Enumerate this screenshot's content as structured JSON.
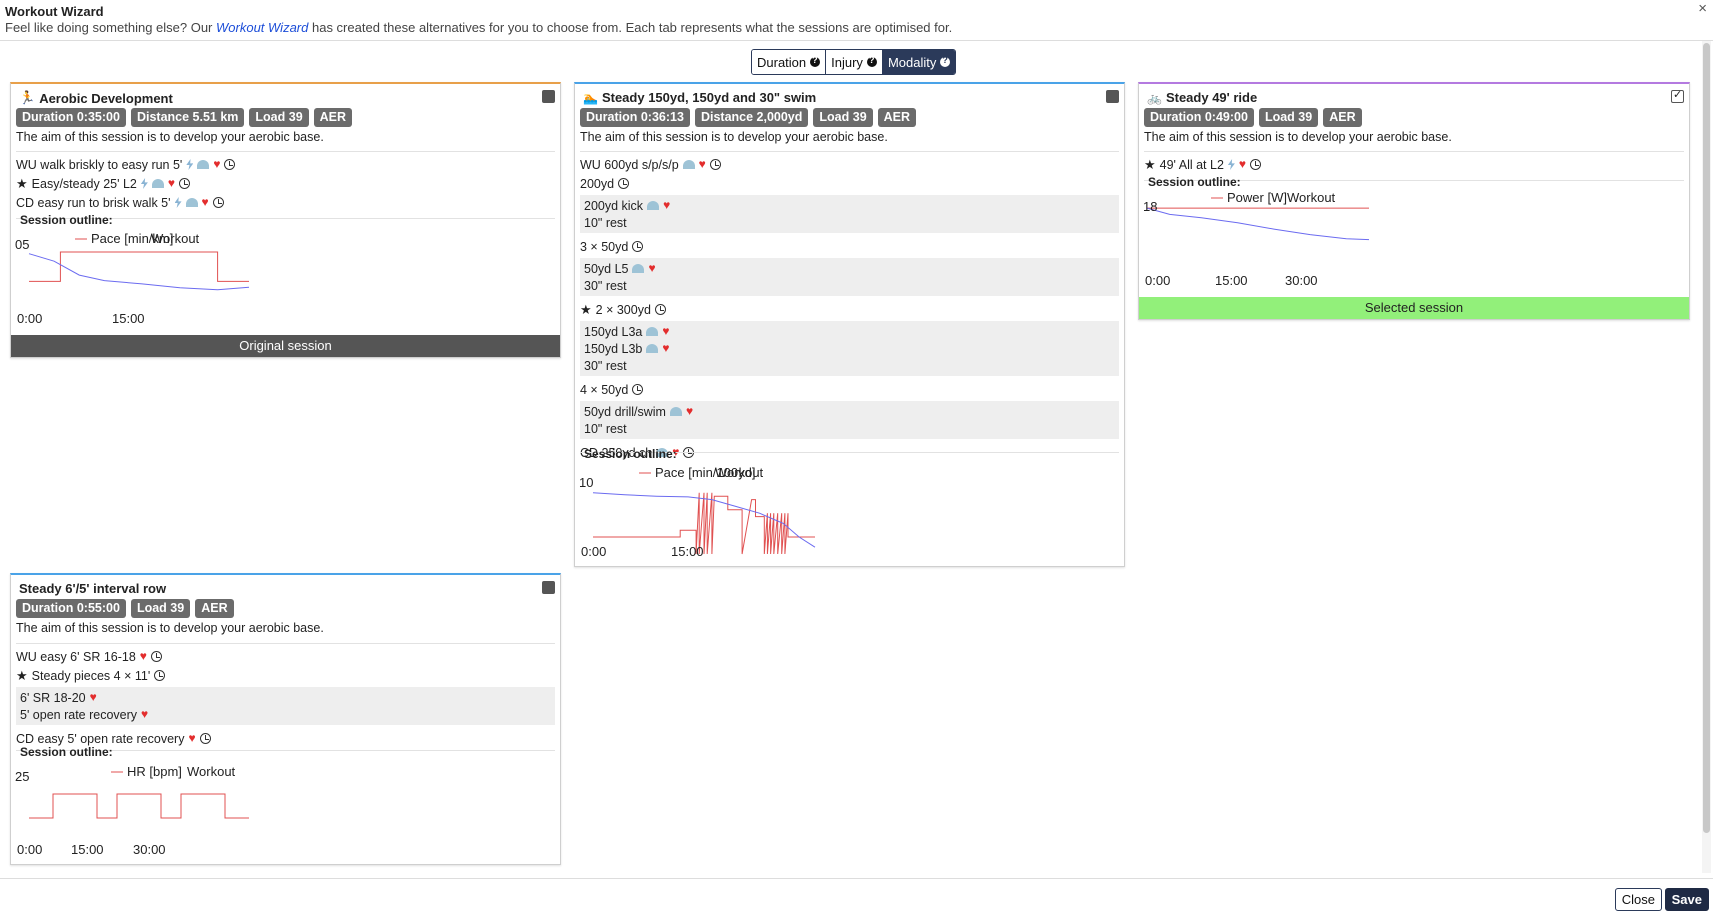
{
  "dialog": {
    "title": "Workout Wizard",
    "subtitle_pre": "Feel like doing something else? Our ",
    "subtitle_link": "Workout Wizard",
    "subtitle_post": " has created these alternatives for you to choose from. Each tab represents what the sessions are optimised for.",
    "close_x": "×"
  },
  "tabs": [
    {
      "label": "Duration",
      "active": false
    },
    {
      "label": "Injury",
      "active": false
    },
    {
      "label": "Modality",
      "active": true
    }
  ],
  "cards": {
    "run": {
      "title": "Aerobic Development",
      "border_color": "#e8a04a",
      "checked": false,
      "badges": [
        "Duration 0:35:00",
        "Distance 5.51 km",
        "Load 39",
        "AER"
      ],
      "aim": "The aim of this session is to develop your aerobic base.",
      "steps": [
        {
          "text": "WU walk briskly to easy run 5'",
          "icons": [
            "bolt",
            "gauge",
            "heart",
            "clock"
          ]
        },
        {
          "text": "Easy/steady 25' L2",
          "star": true,
          "icons": [
            "bolt",
            "gauge",
            "heart",
            "clock"
          ]
        },
        {
          "text": "CD easy run to brisk walk 5'",
          "icons": [
            "bolt",
            "gauge",
            "heart",
            "clock"
          ]
        }
      ],
      "outline_label": "Session outline:",
      "footer": "Original session"
    },
    "swim": {
      "title": "Steady 150yd, 150yd and 30\" swim",
      "border_color": "#4aa3e8",
      "checked": false,
      "badges": [
        "Duration 0:36:13",
        "Distance 2,000yd",
        "Load 39",
        "AER"
      ],
      "aim": "The aim of this session is to develop your aerobic base.",
      "outline_label": "Session outline:",
      "steps": {
        "wu": "WU 600yd s/p/s/p",
        "s200": "200yd",
        "g1a": "200yd kick",
        "g1b": "10\" rest",
        "rep3": "3 × 50yd",
        "g2a": "50yd L5",
        "g2b": "30\" rest",
        "rep2": "2 × 300yd",
        "g3a": "150yd L3a",
        "g3b": "150yd L3b",
        "g3c": "30\" rest",
        "rep4": "4 × 50yd",
        "g4a": "50yd drill/swim",
        "g4b": "10\" rest",
        "cd": "CD 250yd ch"
      }
    },
    "ride": {
      "title": "Steady 49' ride",
      "border_color": "#b47ae0",
      "checked": true,
      "badges": [
        "Duration 0:49:00",
        "Load 39",
        "AER"
      ],
      "aim": "The aim of this session is to develop your aerobic base.",
      "steps": [
        {
          "text": "49' All at L2",
          "star": true,
          "icons": [
            "bolt",
            "heart",
            "clock"
          ]
        }
      ],
      "outline_label": "Session outline:",
      "footer": "Selected session"
    },
    "row": {
      "title": "Steady 6'/5' interval row",
      "border_color": "#4aa3e8",
      "checked": false,
      "badges": [
        "Duration 0:55:00",
        "Load 39",
        "AER"
      ],
      "aim": "The aim of this session is to develop your aerobic base.",
      "outline_label": "Session outline:",
      "steps": {
        "wu": "WU easy 6' SR 16-18",
        "main": "Steady pieces 4 × 11'",
        "g1a": "6' SR 18-20",
        "g1b": "5' open rate recovery",
        "cd": "CD easy 5' open rate recovery"
      }
    }
  },
  "chart_data": [
    {
      "type": "line",
      "legend": [
        "Pace [min/km]",
        "Workout"
      ],
      "x_tick_labels": [
        "0:00",
        "15:00"
      ],
      "y_tick_labels": [
        "05"
      ],
      "series": [
        {
          "name": "Workout",
          "color": "#e05050",
          "x": [
            0,
            5,
            5,
            30,
            30,
            35
          ],
          "y": [
            0.3,
            0.3,
            1.0,
            1.0,
            0.3,
            0.3
          ]
        },
        {
          "name": "Pace [min/km]",
          "color": "#6b6bf0",
          "x": [
            0,
            4,
            8,
            12,
            18,
            24,
            30,
            35
          ],
          "y": [
            0.96,
            0.78,
            0.45,
            0.32,
            0.24,
            0.15,
            0.1,
            0.16
          ]
        }
      ]
    },
    {
      "type": "line",
      "legend": [
        "Pace [min/100yd]",
        "Workout"
      ],
      "x_tick_labels": [
        "0:00",
        "15:00"
      ],
      "y_tick_labels": [
        "10"
      ],
      "series": [
        {
          "name": "Workout",
          "color": "#e05050",
          "x": [
            0,
            11,
            11,
            13,
            13,
            13.4,
            13.4,
            14,
            14,
            14.4,
            14.4,
            15,
            15,
            15.3,
            15.3,
            17,
            17,
            18.8,
            18.8,
            20,
            20,
            20.5,
            20.5,
            21.6,
            21.6,
            22,
            22,
            22.4,
            22.4,
            22.8,
            22.8,
            23.3,
            23.3,
            23.8,
            23.8,
            24.2,
            24.2,
            24.6,
            24.6,
            25.2,
            25.2,
            28
          ],
          "y": [
            0.25,
            0.25,
            0.35,
            0.35,
            0.0,
            0.9,
            0.0,
            0.9,
            0.0,
            0.9,
            0.0,
            0.9,
            0.0,
            0.85,
            0.85,
            0.85,
            0.65,
            0.65,
            0.0,
            0.8,
            0.8,
            0.8,
            0.55,
            0.55,
            0.0,
            0.6,
            0.0,
            0.6,
            0.0,
            0.6,
            0.0,
            0.6,
            0.0,
            0.6,
            0.0,
            0.6,
            0.0,
            0.6,
            0.25,
            0.25,
            0.25,
            0.25
          ]
        },
        {
          "name": "Pace [min/100yd]",
          "color": "#6b6bf0",
          "x": [
            0,
            4,
            8,
            12,
            15,
            18,
            21,
            24,
            26,
            28
          ],
          "y": [
            0.9,
            0.87,
            0.85,
            0.84,
            0.8,
            0.7,
            0.6,
            0.45,
            0.25,
            0.1
          ]
        }
      ]
    },
    {
      "type": "line",
      "legend": [
        "Power [W]",
        "Workout"
      ],
      "x_tick_labels": [
        "0:00",
        "15:00",
        "30:00"
      ],
      "y_tick_labels": [
        "18"
      ],
      "series": [
        {
          "name": "Workout",
          "color": "#e05050",
          "x": [
            0,
            49
          ],
          "y": [
            0.95,
            0.95
          ]
        },
        {
          "name": "Power [W]",
          "color": "#6b6bf0",
          "x": [
            0,
            5,
            12,
            20,
            28,
            36,
            44,
            49
          ],
          "y": [
            0.95,
            0.8,
            0.72,
            0.6,
            0.45,
            0.32,
            0.22,
            0.2
          ]
        }
      ]
    },
    {
      "type": "line",
      "legend": [
        "HR [bpm]",
        "Workout"
      ],
      "x_tick_labels": [
        "0:00",
        "15:00",
        "30:00"
      ],
      "y_tick_labels": [
        "25"
      ],
      "series": [
        {
          "name": "Workout",
          "color": "#e05050",
          "x": [
            0,
            6,
            6,
            17,
            17,
            22,
            22,
            33,
            33,
            38,
            38,
            49,
            49,
            54,
            54,
            55
          ],
          "y": [
            0.2,
            0.2,
            0.8,
            0.8,
            0.2,
            0.2,
            0.8,
            0.8,
            0.2,
            0.2,
            0.8,
            0.8,
            0.2,
            0.2,
            0.2,
            0.2
          ]
        }
      ]
    }
  ],
  "footer_buttons": {
    "close": "Close",
    "save": "Save"
  }
}
